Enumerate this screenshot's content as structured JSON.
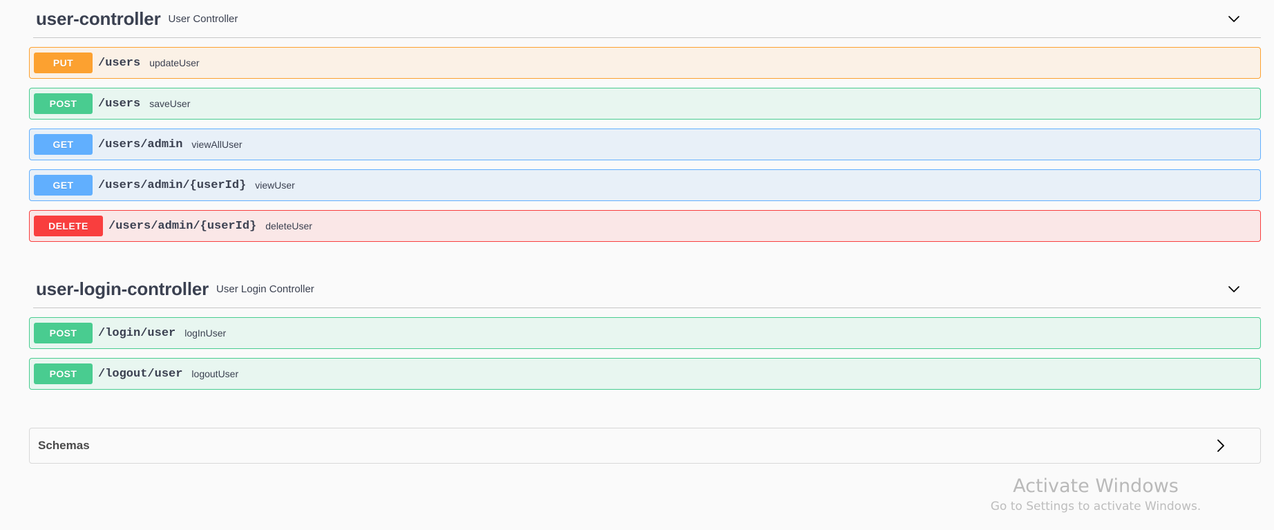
{
  "colors": {
    "put": "#fca130",
    "post": "#49cc90",
    "get": "#61affe",
    "delete": "#f93e3e",
    "text": "#3b4151",
    "page_background": "#fafafa"
  },
  "sections": [
    {
      "title": "user-controller",
      "description": "User Controller",
      "expanded": true,
      "toggle_icon": "chevron-down-icon",
      "operations": [
        {
          "method": "PUT",
          "path": "/users",
          "summary": "updateUser"
        },
        {
          "method": "POST",
          "path": "/users",
          "summary": "saveUser"
        },
        {
          "method": "GET",
          "path": "/users/admin",
          "summary": "viewAllUser"
        },
        {
          "method": "GET",
          "path": "/users/admin/{userId}",
          "summary": "viewUser"
        },
        {
          "method": "DELETE",
          "path": "/users/admin/{userId}",
          "summary": "deleteUser"
        }
      ]
    },
    {
      "title": "user-login-controller",
      "description": "User Login Controller",
      "expanded": true,
      "toggle_icon": "chevron-down-icon",
      "operations": [
        {
          "method": "POST",
          "path": "/login/user",
          "summary": "logInUser"
        },
        {
          "method": "POST",
          "path": "/logout/user",
          "summary": "logoutUser"
        }
      ]
    }
  ],
  "schemas": {
    "title": "Schemas",
    "expanded": false,
    "toggle_icon": "chevron-right-icon"
  },
  "watermark": {
    "title": "Activate Windows",
    "subtitle": "Go to Settings to activate Windows."
  }
}
